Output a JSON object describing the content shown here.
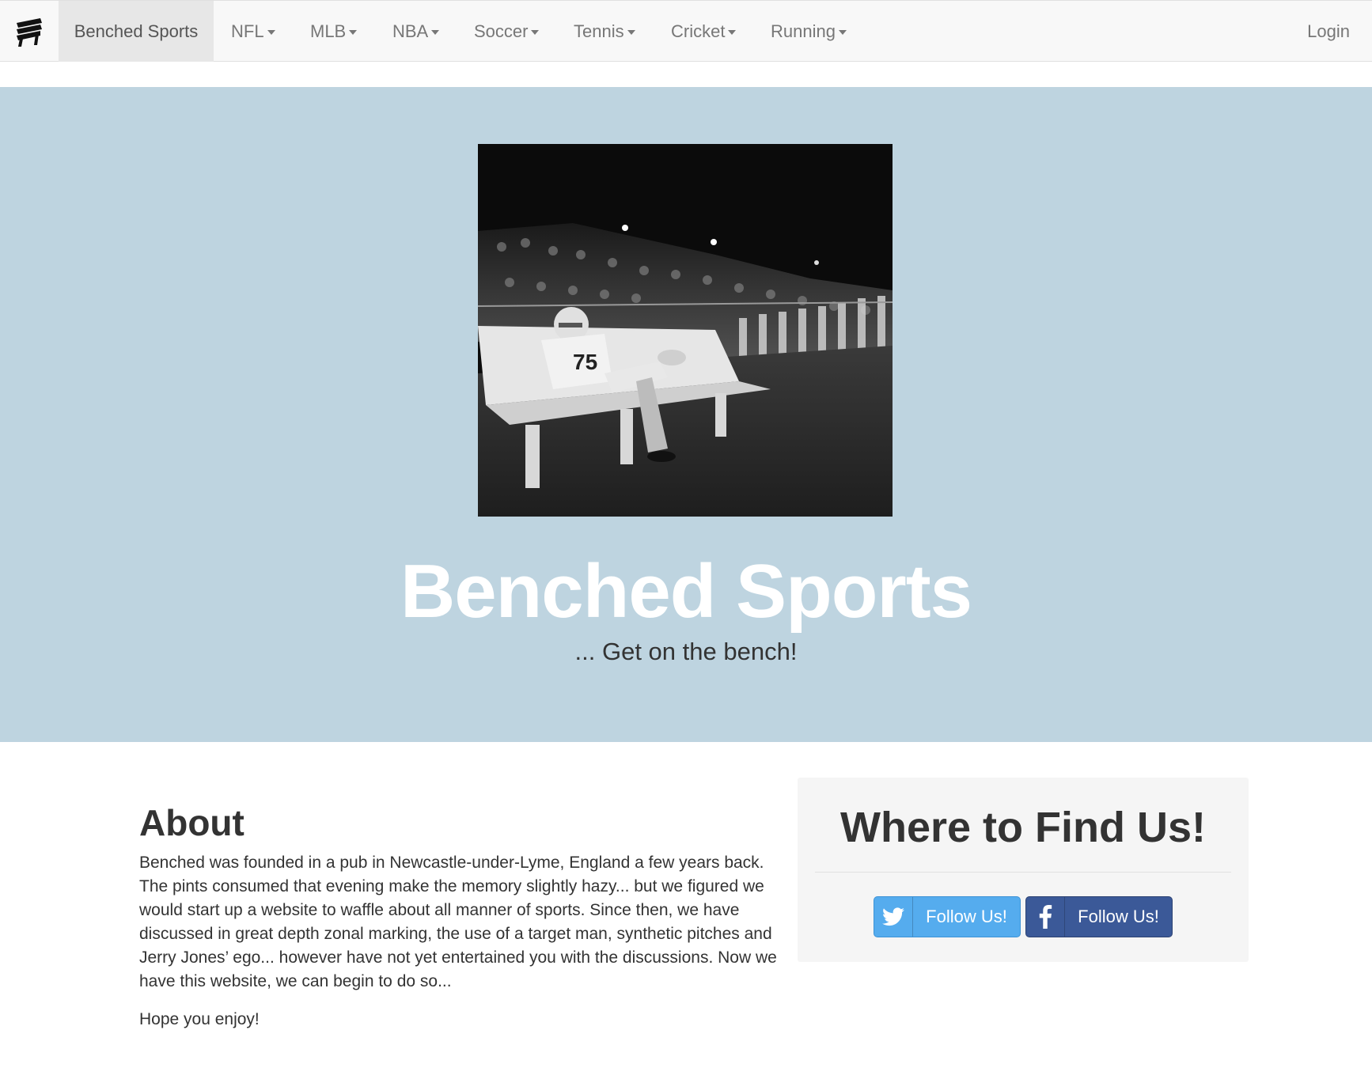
{
  "navbar": {
    "logo_icon": "bench-icon",
    "brand": "Benched Sports",
    "items": [
      {
        "label": "NFL"
      },
      {
        "label": "MLB"
      },
      {
        "label": "NBA"
      },
      {
        "label": "Soccer"
      },
      {
        "label": "Tennis"
      },
      {
        "label": "Cricket"
      },
      {
        "label": "Running"
      }
    ],
    "login": "Login"
  },
  "hero": {
    "background_color": "#bed4e0",
    "title": "Benched Sports",
    "subtitle": "... Get on the bench!",
    "photo_jersey_number": "75"
  },
  "about": {
    "title": "About",
    "body": "Benched was founded in a pub in Newcastle-under-Lyme, England a few years back. The pints consumed that evening make the memory slightly hazy... but we figured we would start up a website to waffle about all manner of sports. Since then, we have discussed in great depth zonal marking, the use of a target man, synthetic pitches and Jerry Jones’ ego... however have not yet entertained you with the discussions. Now we have this website, we can begin to do so...",
    "closing": "Hope you enjoy!"
  },
  "find_us": {
    "title": "Where to Find Us!",
    "twitter": {
      "label": "Follow Us!",
      "icon": "twitter-icon",
      "color": "#55acee"
    },
    "facebook": {
      "label": "Follow Us!",
      "icon": "facebook-icon",
      "color": "#3b5998"
    }
  }
}
